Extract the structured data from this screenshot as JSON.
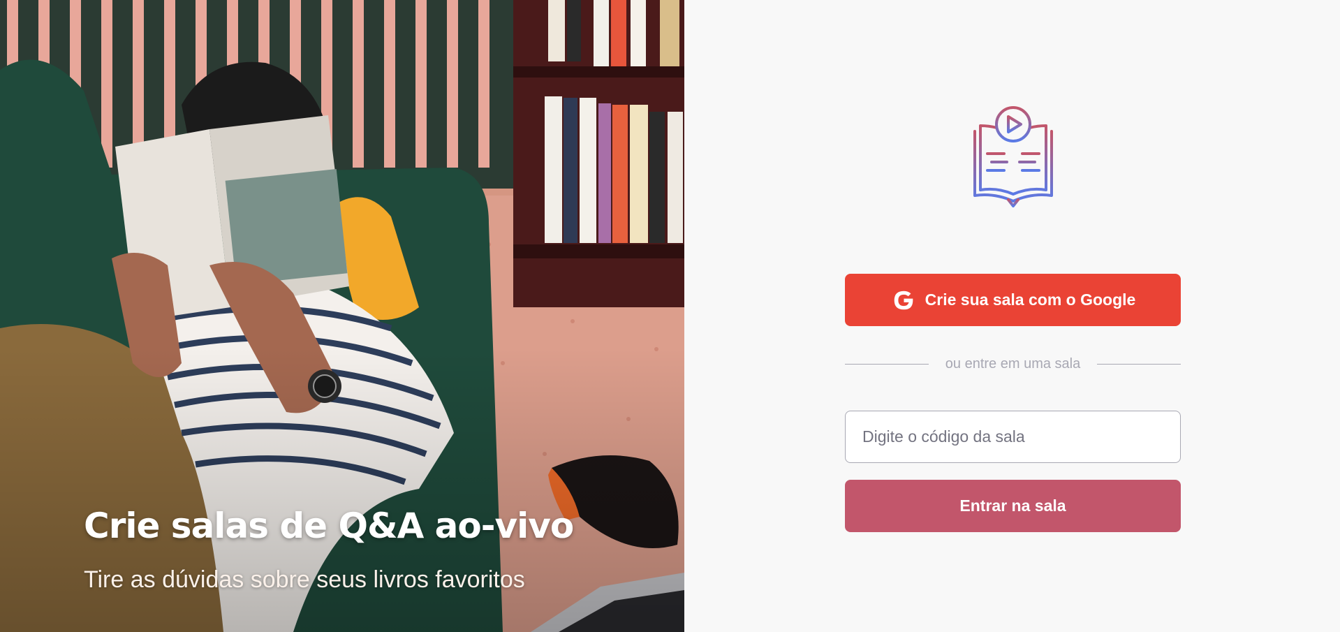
{
  "aside": {
    "headline": "Crie salas de Q&A ao-vivo",
    "subline": "Tire as dúvidas sobre seus livros favoritos",
    "illustration_icon": "person-reading-illustration"
  },
  "main": {
    "logo_icon": "book-play-icon",
    "google_button": {
      "label": "Crie sua sala com o Google",
      "icon": "google-icon"
    },
    "separator": "ou entre em uma sala",
    "room_input": {
      "placeholder": "Digite o código da sala",
      "value": ""
    },
    "enter_button": "Entrar na sala"
  },
  "colors": {
    "google": "#ea4335",
    "enter": "#c2566b",
    "logo_gradient_start": "#c2566b",
    "logo_gradient_end": "#5a7ae6",
    "background": "#f8f8f8",
    "muted": "#a8a8b3"
  }
}
